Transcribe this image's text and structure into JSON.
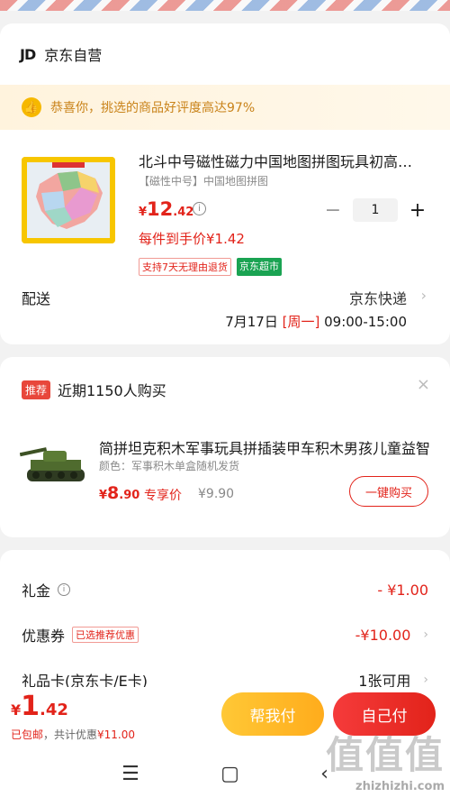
{
  "store": {
    "logo": "JD",
    "name": "京东自营"
  },
  "banner": {
    "icon": "thumbs-up-icon",
    "text": "恭喜你，挑选的商品好评度高达97%"
  },
  "product": {
    "title": "北斗中号磁性磁力中国地图拼图玩具初高中生地理",
    "spec": "【磁性中号】中国地图拼图",
    "price_yen": "¥",
    "price_int": "12",
    "price_dec": ".42",
    "each_price": "每件到手价¥1.42",
    "quantity": "1",
    "minus": "−",
    "plus": "+",
    "tag_return": "支持7天无理由退货",
    "tag_market": "京东超市"
  },
  "delivery": {
    "label": "配送",
    "method": "京东快递",
    "date": "7月17日",
    "weekday": "[周一]",
    "time": "09:00-15:00"
  },
  "recommend": {
    "badge": "推荐",
    "title": "近期1150人购买",
    "close": "×",
    "item_title": "简拼坦克积木军事玩具拼插装甲车积木男孩儿童益智",
    "item_spec": "颜色：军事积木单盒随机发货",
    "price_yen": "¥",
    "price_int": "8",
    "price_dec": ".90",
    "special_label": "专享价",
    "orig_price": "¥9.90",
    "buy_label": "一键购买"
  },
  "summary": {
    "gift_label": "礼金",
    "gift_value": "- ¥1.00",
    "coupon_label": "优惠券",
    "coupon_tag": "已选推荐优惠",
    "coupon_value": "-¥10.00",
    "card_label": "礼品卡(京东卡/E卡)",
    "card_value": "1张可用"
  },
  "footer": {
    "total_yen": "¥",
    "total_int": "1",
    "total_dec": ".42",
    "note_shipping": "已包邮",
    "note_discount_label": "，共计优惠",
    "note_discount_value": "¥11.00",
    "help_pay": "帮我付",
    "self_pay": "自己付"
  },
  "watermark": {
    "big": "值值值",
    "small": "zhizhizhi.com"
  },
  "colors": {
    "accent": "#e2231a",
    "gold": "#ffb822",
    "green": "#1aa352"
  }
}
